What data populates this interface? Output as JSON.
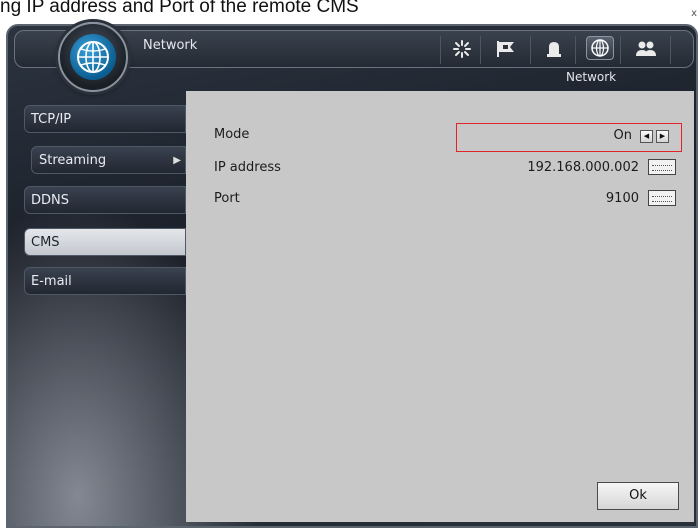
{
  "caption": "ng IP address and Port of the remote CMS",
  "window": {
    "close_glyph": "x",
    "title": "Network",
    "subtitle": "Network",
    "toolbar_icons": [
      {
        "name": "setup-icon",
        "active": false
      },
      {
        "name": "event-flag-icon",
        "active": false
      },
      {
        "name": "alarm-icon",
        "active": false
      },
      {
        "name": "network-globe-icon",
        "active": true
      },
      {
        "name": "users-icon",
        "active": false
      }
    ]
  },
  "sidebar": {
    "items": [
      {
        "label": "TCP/IP",
        "selected": false
      },
      {
        "label": "Streaming",
        "selected": false,
        "has_arrow": true
      },
      {
        "label": "DDNS",
        "selected": false
      },
      {
        "label": "CMS",
        "selected": true
      },
      {
        "label": "E-mail",
        "selected": false
      }
    ],
    "arrow_glyph": "▶"
  },
  "form": {
    "mode": {
      "label": "Mode",
      "value": "On"
    },
    "ip": {
      "label": "IP address",
      "value": "192.168.000.002"
    },
    "port": {
      "label": "Port",
      "value": "9100"
    }
  },
  "ok_label": "Ok",
  "colors": {
    "highlight_box": "#e0242a",
    "panel_bg": "#c8c8c8"
  }
}
